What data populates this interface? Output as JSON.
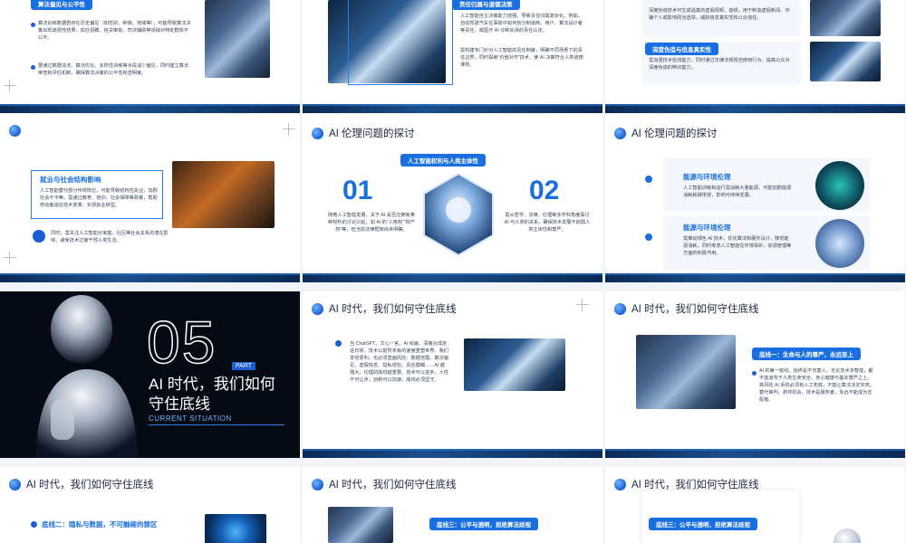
{
  "slides": {
    "s1": {
      "pill": "算法偏见与公平性",
      "p1": "算法训练数据若存在历史偏见（如性别、种族、地域等），可能导致算法决策出现歧视性结果，如在招聘、信贷审批、司法辅助等领域对特定群体不公平。",
      "p2": "要通过数据清洗、算法优化、多样性训练等手段减少偏见，同时建立算法审查和评估机制，确保算法决策的公平性和透明度。"
    },
    "s2": {
      "pill": "责任归属与道德决策",
      "p1": "人工智能自主决策能力增强，导致责任归属复杂化。例如，自动驾驶汽车在事故中如何划分制造商、用户、算法设计者等责任，或医疗 AI 诊断失误的责任认定。",
      "p2": "需构建专门针对人工智能的责任制度，明确不同场景下的责任边界，同时探索“价值对齐”技术，使 AI 决策符合人类道德准则。"
    },
    "s3": {
      "p1": "深度伪造技术可生成逼真的虚假视频、音频，用于制造虚假新闻、诈骗个人或影响政治选举，威胁信息真实性和公众信任。",
      "pill": "深度伪造与信息真实性",
      "p2": "需加强技术检测能力，同时通过法律法规规范使用行为，提高公众对深度伪造的辨识能力。"
    },
    "s4": {
      "box_title": "就业与社会结构影响",
      "p1": "人工智能替代部分传统岗位，可能导致结构性失业，加剧社会不平等。需通过教育、培训、社会保障等政策，帮助劳动者适应技术变革，实现就业转型。",
      "p2": "同时，需关注人工智能对家庭、社区等社会关系的潜在影响，避免技术过度干预人类生活。"
    },
    "s5": {
      "title": "AI 伦理问题的探讨",
      "pill": "人工智能权利与人类主体性",
      "n1": "01",
      "n2": "02",
      "p1": "随着人工智能发展，关于 AI 是否应拥有某种权利的讨论兴起，如 AI 的“人格权”“财产权”等，但当前法律框架尚未明确。",
      "p2": "需从哲学、法律、伦理等多学科角度探讨 AI 与人类的关系，确保技术发展不削弱人类主体性和尊严。"
    },
    "s6": {
      "title": "AI 伦理问题的探讨",
      "c1_title": "能源与环境伦理",
      "c1_text": "人工智能训练和运行需消耗大量能源，可能加剧能源消耗和碳排放，影响可持续发展。",
      "c2_title": "能源与环境伦理",
      "c2_text": "需推动绿色 AI 技术，优化算法和硬件设计，降低能源消耗，同时考虑人工智能在环境保护、资源管理等方面的积极作用。"
    },
    "s7": {
      "big": "05",
      "part": "PART",
      "title": "AI 时代，我们如何守住底线",
      "sub": "CURRENT SITUATION"
    },
    "s8": {
      "title": "AI 时代，我们如何守住底线",
      "p1": "当 ChatGPT、文心一言、AI 绘画、深度合成走进日常，技术以前所未有的速度重塑世界。我们享受便利，也必须直面风险：数据泄露、算法偏见、虚假信息、隐私侵犯、责任模糊……AI 越强大，伦理的底线越重要。技术可以进步，人性不可让步；创新可以加速，底线必须坚守。"
    },
    "s9": {
      "title": "AI 时代，我们如何守住底线",
      "pill": "底线一：生命与人的尊严，永远至上",
      "p1": "AI 的第一底线，始终是不伤害人。无论技术多智能，都不能凌驾于人类生命安全、身心健康与基本尊严之上。高风险 AI 系统必须有人工兜底，不能让算法决定实死、替代审判、剥夺机会。技术是服务者，永远不能成为支配者。"
    },
    "s10": {
      "title": "AI 时代，我们如何守住底线",
      "sub": "底线二：隐私与数据，不可触碰的禁区"
    },
    "s11": {
      "title": "AI 时代，我们如何守住底线",
      "pill": "底线三：公平与透明，拒绝算法歧视"
    },
    "s12": {
      "title": "AI 时代，我们如何守住底线",
      "pill": "底线三：公平与透明，拒绝算法歧视"
    }
  }
}
